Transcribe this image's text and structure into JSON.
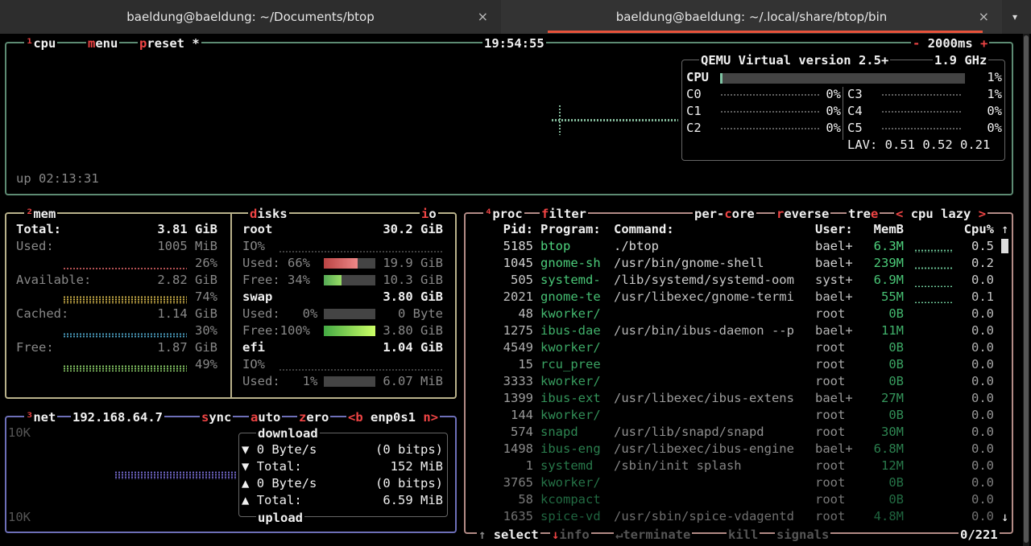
{
  "tabs": [
    {
      "title": "baeldung@baeldung: ~/Documents/btop",
      "close": "×"
    },
    {
      "title": "baeldung@baeldung: ~/.local/share/btop/bin",
      "close": "×"
    }
  ],
  "tab_menu": "▾",
  "cpu": {
    "label_num": "¹",
    "label": "cpu",
    "menu_hl": "m",
    "menu_rest": "enu",
    "preset_hl": "p",
    "preset_rest": "reset *",
    "clock": "19:54:55",
    "interval_minus": "-",
    "interval": "2000ms",
    "interval_plus": "+",
    "uptime": "up 02:13:31",
    "model": "QEMU Virtual version 2.5+",
    "freq": "1.9 GHz",
    "total_label": "CPU",
    "total_pct": "1%",
    "total_fill": 0.01,
    "cores": [
      {
        "name": "C0",
        "pct": "0%"
      },
      {
        "name": "C3",
        "pct": "1%"
      },
      {
        "name": "C1",
        "pct": "0%"
      },
      {
        "name": "C4",
        "pct": "0%"
      },
      {
        "name": "C2",
        "pct": "0%"
      },
      {
        "name": "C5",
        "pct": "0%"
      }
    ],
    "lav_label": "LAV:",
    "lav": "0.51 0.52 0.21"
  },
  "mem": {
    "label_num": "²",
    "label": "mem",
    "total_label": "Total:",
    "total": "3.81 GiB",
    "used_label": "Used:",
    "used": "1005 MiB",
    "used_pct": "26%",
    "available_label": "Available:",
    "available": "2.82 GiB",
    "available_pct": "74%",
    "cached_label": "Cached:",
    "cached": "1.14 GiB",
    "cached_pct": "30%",
    "free_label": "Free:",
    "free": "1.87 GiB",
    "free_pct": "49%"
  },
  "disks": {
    "label_hl": "d",
    "label_rest": "isks",
    "io_label_hl": "i",
    "io_label_rest": "o",
    "root_name": "root",
    "root_size": "30.2 GiB",
    "root_io": "IO%",
    "root_used_label": "Used: 66%",
    "root_used": "19.9 GiB",
    "root_used_fill": 0.66,
    "root_free_label": "Free: 34%",
    "root_free": "10.3 GiB",
    "root_free_fill": 0.34,
    "swap_name": "swap",
    "swap_size": "3.80 GiB",
    "swap_used_label": "Used:   0%",
    "swap_used": "0 Byte",
    "swap_used_fill": 0.0,
    "swap_free_label": "Free:100%",
    "swap_free": "3.80 GiB",
    "swap_free_fill": 1.0,
    "efi_name": "efi",
    "efi_size": "1.04 GiB",
    "efi_io": "IO%",
    "efi_used_label": "Used:   1%",
    "efi_used": "6.07 MiB",
    "efi_used_fill": 0.01
  },
  "net": {
    "label_num": "³",
    "label": "net",
    "ip": "192.168.64.7",
    "sync_hl": "s",
    "sync_rest": "ync",
    "auto_hl": "a",
    "auto_rest": "uto",
    "zero_hl": "z",
    "zero_rest": "ero",
    "prev": "<b",
    "iface": "enp0s1",
    "next": "n>",
    "scale_top": "10K",
    "scale_bottom": "10K",
    "download_title": "download",
    "down_rate": "0 Byte/s",
    "down_bits": "(0 bitps)",
    "down_total_label": "Total:",
    "down_total": "152 MiB",
    "up_rate": "0 Byte/s",
    "up_bits": "(0 bitps)",
    "up_total_label": "Total:",
    "up_total": "6.59 MiB",
    "upload_title": "upload",
    "arrow_down": "▼",
    "arrow_up": "▲"
  },
  "proc": {
    "label_num": "⁴",
    "label": "proc",
    "filter_hl": "f",
    "filter_rest": "ilter",
    "percore_a": "per-",
    "percore_hl": "c",
    "percore_b": "ore",
    "reverse_hl": "r",
    "reverse_rest": "everse",
    "tree_a": "tre",
    "tree_hl": "e",
    "sort_prev": "<",
    "sort": "cpu lazy",
    "sort_next": ">",
    "headers": {
      "pid": "Pid:",
      "program": "Program:",
      "command": "Command:",
      "user": "User:",
      "mem": "MemB",
      "cpu": "Cpu%"
    },
    "scroll_up": "↑",
    "scroll_down": "↓",
    "rows": [
      {
        "pid": "5185",
        "program": "btop",
        "command": "./btop",
        "user": "bael+",
        "mem": "6.3M",
        "cpu": "0.5",
        "graph": 0.6
      },
      {
        "pid": "1045",
        "program": "gnome-sh",
        "command": "/usr/bin/gnome-shell",
        "user": "bael+",
        "mem": "239M",
        "cpu": "0.2",
        "graph": 0.5
      },
      {
        "pid": "505",
        "program": "systemd-",
        "command": "/lib/systemd/systemd-oom",
        "user": "syst+",
        "mem": "6.9M",
        "cpu": "0.0",
        "graph": 0.2
      },
      {
        "pid": "2021",
        "program": "gnome-te",
        "command": "/usr/libexec/gnome-termi",
        "user": "bael+",
        "mem": "55M",
        "cpu": "0.1",
        "graph": 0.4
      },
      {
        "pid": "48",
        "program": "kworker/",
        "command": "",
        "user": "root",
        "mem": "0B",
        "cpu": "0.0",
        "graph": 0
      },
      {
        "pid": "1275",
        "program": "ibus-dae",
        "command": "/usr/bin/ibus-daemon --p",
        "user": "bael+",
        "mem": "11M",
        "cpu": "0.0",
        "graph": 0
      },
      {
        "pid": "4549",
        "program": "kworker/",
        "command": "",
        "user": "root",
        "mem": "0B",
        "cpu": "0.0",
        "graph": 0
      },
      {
        "pid": "15",
        "program": "rcu_pree",
        "command": "",
        "user": "root",
        "mem": "0B",
        "cpu": "0.0",
        "graph": 0
      },
      {
        "pid": "3333",
        "program": "kworker/",
        "command": "",
        "user": "root",
        "mem": "0B",
        "cpu": "0.0",
        "graph": 0
      },
      {
        "pid": "1399",
        "program": "ibus-ext",
        "command": "/usr/libexec/ibus-extens",
        "user": "bael+",
        "mem": "27M",
        "cpu": "0.0",
        "graph": 0
      },
      {
        "pid": "144",
        "program": "kworker/",
        "command": "",
        "user": "root",
        "mem": "0B",
        "cpu": "0.0",
        "graph": 0
      },
      {
        "pid": "574",
        "program": "snapd",
        "command": "/usr/lib/snapd/snapd",
        "user": "root",
        "mem": "30M",
        "cpu": "0.0",
        "graph": 0
      },
      {
        "pid": "1498",
        "program": "ibus-eng",
        "command": "/usr/libexec/ibus-engine",
        "user": "bael+",
        "mem": "6.8M",
        "cpu": "0.0",
        "graph": 0
      },
      {
        "pid": "1",
        "program": "systemd",
        "command": "/sbin/init splash",
        "user": "root",
        "mem": "12M",
        "cpu": "0.0",
        "graph": 0
      },
      {
        "pid": "3765",
        "program": "kworker/",
        "command": "",
        "user": "root",
        "mem": "0B",
        "cpu": "0.0",
        "graph": 0
      },
      {
        "pid": "58",
        "program": "kcompact",
        "command": "",
        "user": "root",
        "mem": "0B",
        "cpu": "0.0",
        "graph": 0
      },
      {
        "pid": "1635",
        "program": "spice-vd",
        "command": "/usr/sbin/spice-vdagentd",
        "user": "root",
        "mem": "4.8M",
        "cpu": "0.0",
        "graph": 0
      }
    ],
    "footer": {
      "select_arrow": "↑",
      "select": "select",
      "info_arrow": "↓",
      "info": "info",
      "terminate_arrow": "↵",
      "terminate": "terminate",
      "kill": "kill",
      "signals": "signals",
      "count": "0/221"
    }
  },
  "colors": {
    "cpu_box": "#5d8b73",
    "mem_box": "#b9b28b",
    "proc_box": "#b38b86",
    "net_box": "#6d6fb8",
    "hotkey": "#e44444",
    "program": "#4fd37e",
    "tab_accent": "#e9533b"
  }
}
